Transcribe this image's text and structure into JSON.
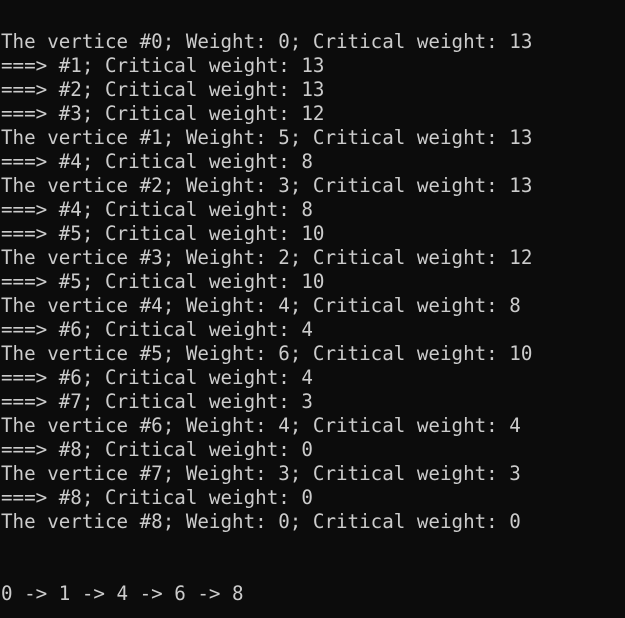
{
  "terminal": {
    "lines": [
      "The vertice #0; Weight: 0; Critical weight: 13",
      "===> #1; Critical weight: 13",
      "===> #2; Critical weight: 13",
      "===> #3; Critical weight: 12",
      "The vertice #1; Weight: 5; Critical weight: 13",
      "===> #4; Critical weight: 8",
      "The vertice #2; Weight: 3; Critical weight: 13",
      "===> #4; Critical weight: 8",
      "===> #5; Critical weight: 10",
      "The vertice #3; Weight: 2; Critical weight: 12",
      "===> #5; Critical weight: 10",
      "The vertice #4; Weight: 4; Critical weight: 8",
      "===> #6; Critical weight: 4",
      "The vertice #5; Weight: 6; Critical weight: 10",
      "===> #6; Critical weight: 4",
      "===> #7; Critical weight: 3",
      "The vertice #6; Weight: 4; Critical weight: 4",
      "===> #8; Critical weight: 0",
      "The vertice #7; Weight: 3; Critical weight: 3",
      "===> #8; Critical weight: 0",
      "The vertice #8; Weight: 0; Critical weight: 0"
    ],
    "critical_path": "0 -> 1 -> 4 -> 6 -> 8",
    "background_color": "#0c0c0c",
    "text_color": "#cccccc"
  }
}
